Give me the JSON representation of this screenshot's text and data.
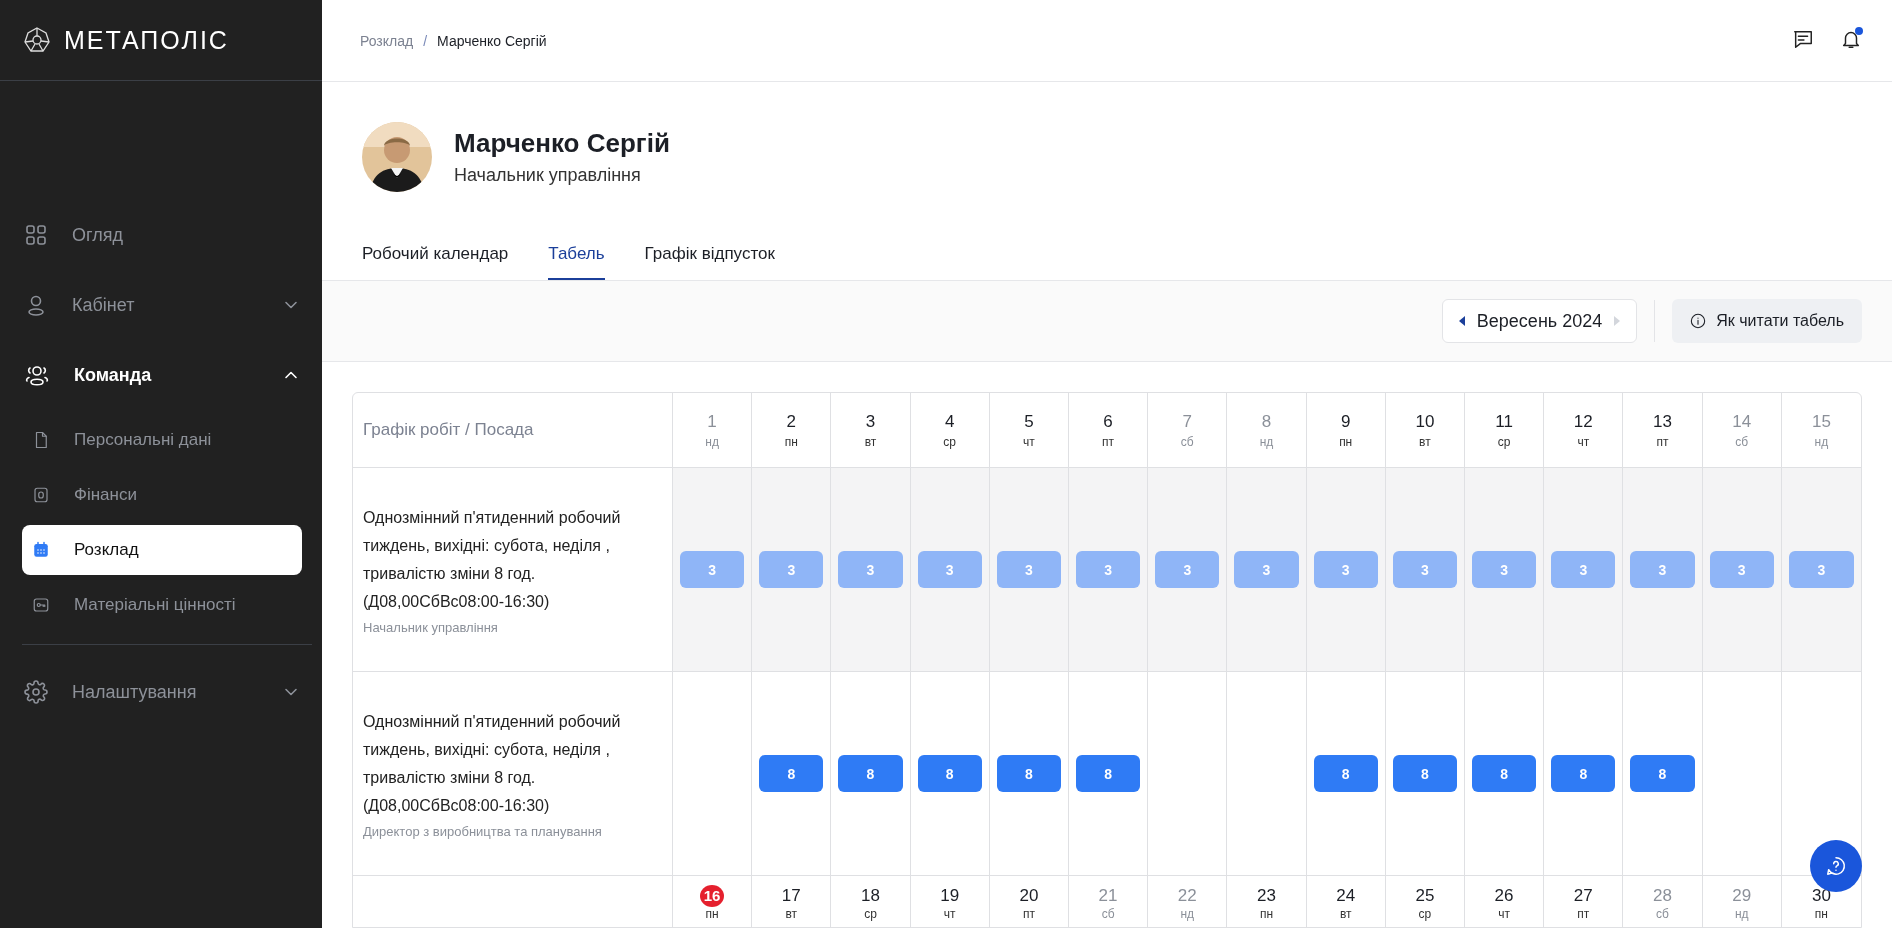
{
  "sidebar": {
    "logo": "МЕТАПОЛІС",
    "sections": [
      [
        {
          "kind": "link",
          "label": "Огляд",
          "selected": false
        },
        {
          "kind": "group",
          "label": "Кабінет",
          "selected": false,
          "expanded": false
        },
        {
          "kind": "group",
          "label": "Команда",
          "selected": true,
          "expanded": true,
          "children": [
            {
              "label": "Персональні дані",
              "selected": false
            },
            {
              "label": "Фінанси",
              "selected": false
            },
            {
              "label": "Розклад",
              "selected": true
            },
            {
              "label": "Матеріальні цінності",
              "selected": false
            }
          ]
        }
      ],
      [
        {
          "kind": "group",
          "label": "Налаштування",
          "selected": false,
          "expanded": false
        }
      ]
    ]
  },
  "header": {
    "breadcrumbs": [
      "Розклад",
      "Марченко Сергій"
    ],
    "separator": "/",
    "has_unread": true
  },
  "profile": {
    "name": "Марченко Сергій",
    "position": "Начальник управління"
  },
  "tabs": [
    {
      "label": "Робочий календар",
      "selected": false
    },
    {
      "label": "Табель",
      "selected": true
    },
    {
      "label": "Графік відпусток",
      "selected": false
    }
  ],
  "toolbar": {
    "month": "Вересень 2024",
    "prev_disabled": false,
    "next_disabled": true,
    "help": "Як читати табель"
  },
  "table": {
    "header": "Графік робіт / Посада",
    "days": [
      {
        "day": "1",
        "weekday": "нд",
        "weekend": true,
        "today": false
      },
      {
        "day": "2",
        "weekday": "пн",
        "weekend": false,
        "today": false
      },
      {
        "day": "3",
        "weekday": "вт",
        "weekend": false,
        "today": false
      },
      {
        "day": "4",
        "weekday": "ср",
        "weekend": false,
        "today": false
      },
      {
        "day": "5",
        "weekday": "чт",
        "weekend": false,
        "today": false
      },
      {
        "day": "6",
        "weekday": "пт",
        "weekend": false,
        "today": false
      },
      {
        "day": "7",
        "weekday": "сб",
        "weekend": true,
        "today": false
      },
      {
        "day": "8",
        "weekday": "нд",
        "weekend": true,
        "today": false
      },
      {
        "day": "9",
        "weekday": "пн",
        "weekend": false,
        "today": false
      },
      {
        "day": "10",
        "weekday": "вт",
        "weekend": false,
        "today": false
      },
      {
        "day": "11",
        "weekday": "ср",
        "weekend": false,
        "today": false
      },
      {
        "day": "12",
        "weekday": "чт",
        "weekend": false,
        "today": false
      },
      {
        "day": "13",
        "weekday": "пт",
        "weekend": false,
        "today": false
      },
      {
        "day": "14",
        "weekday": "сб",
        "weekend": true,
        "today": false
      },
      {
        "day": "15",
        "weekday": "нд",
        "weekend": true,
        "today": false
      }
    ],
    "rows": [
      {
        "schedule": "Однозмінний п'ятиденний робочий тиждень, вихідні: субота, неділя , тривалістю зміни 8 год. (Д08,00СбВс08:00-16:30)",
        "position": "Начальник управління",
        "inactive": true,
        "cells": [
          "3",
          "3",
          "3",
          "3",
          "3",
          "3",
          "3",
          "3",
          "3",
          "3",
          "3",
          "3",
          "3",
          "3",
          "3"
        ]
      },
      {
        "schedule": "Однозмінний п'ятиденний робочий тиждень, вихідні: субота, неділя , тривалістю зміни 8 год. (Д08,00СбВс08:00-16:30)",
        "position": "Директор з виробництва та планування",
        "inactive": false,
        "cells": [
          null,
          "8",
          "8",
          "8",
          "8",
          "8",
          null,
          null,
          "8",
          "8",
          "8",
          "8",
          "8",
          null,
          null
        ]
      }
    ],
    "days_2": [
      {
        "day": "16",
        "weekday": "пн",
        "weekend": false,
        "today": true
      },
      {
        "day": "17",
        "weekday": "вт",
        "weekend": false,
        "today": false
      },
      {
        "day": "18",
        "weekday": "ср",
        "weekend": false,
        "today": false
      },
      {
        "day": "19",
        "weekday": "чт",
        "weekend": false,
        "today": false
      },
      {
        "day": "20",
        "weekday": "пт",
        "weekend": false,
        "today": false
      },
      {
        "day": "21",
        "weekday": "сб",
        "weekend": true,
        "today": false
      },
      {
        "day": "22",
        "weekday": "нд",
        "weekend": true,
        "today": false
      },
      {
        "day": "23",
        "weekday": "пн",
        "weekend": false,
        "today": false
      },
      {
        "day": "24",
        "weekday": "вт",
        "weekend": false,
        "today": false
      },
      {
        "day": "25",
        "weekday": "ср",
        "weekend": false,
        "today": false
      },
      {
        "day": "26",
        "weekday": "чт",
        "weekend": false,
        "today": false
      },
      {
        "day": "27",
        "weekday": "пт",
        "weekend": false,
        "today": false
      },
      {
        "day": "28",
        "weekday": "сб",
        "weekend": true,
        "today": false
      },
      {
        "day": "29",
        "weekday": "нд",
        "weekend": true,
        "today": false
      },
      {
        "day": "30",
        "weekday": "пн",
        "weekend": false,
        "today": false
      }
    ]
  }
}
